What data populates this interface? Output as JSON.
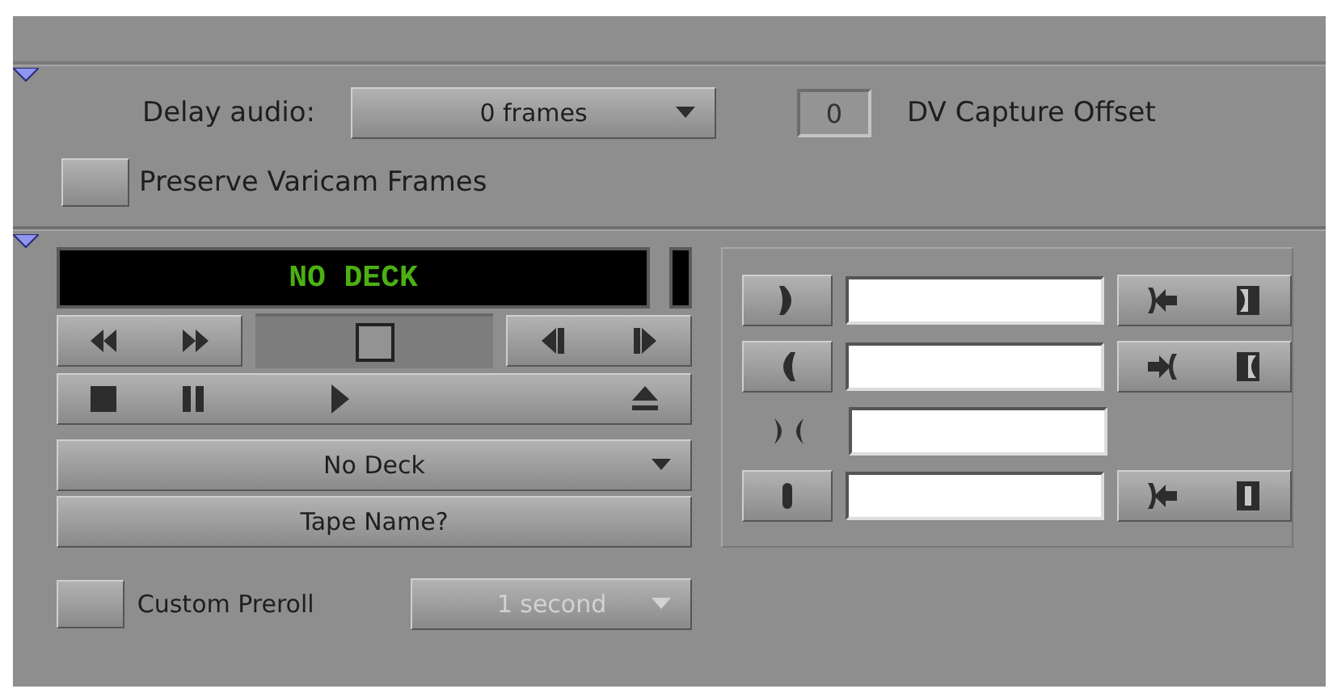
{
  "audio_section": {
    "expanded": true,
    "delay_label": "Delay audio:",
    "delay_value": "0 frames",
    "offset_value": "0",
    "offset_label": "DV Capture Offset",
    "varicam": {
      "label": "Preserve Varicam Frames",
      "checked": false
    }
  },
  "deck_section": {
    "expanded": true,
    "display": "NO DECK",
    "deck_menu": "No Deck",
    "tape_button": "Tape Name?",
    "preroll": {
      "label": "Custom Preroll",
      "checked": false
    },
    "preroll_menu": {
      "value": "1 second",
      "disabled": true
    }
  },
  "timecode_rows": [
    {
      "kind": "in"
    },
    {
      "kind": "out"
    },
    {
      "kind": "duration"
    },
    {
      "kind": "audio"
    }
  ]
}
